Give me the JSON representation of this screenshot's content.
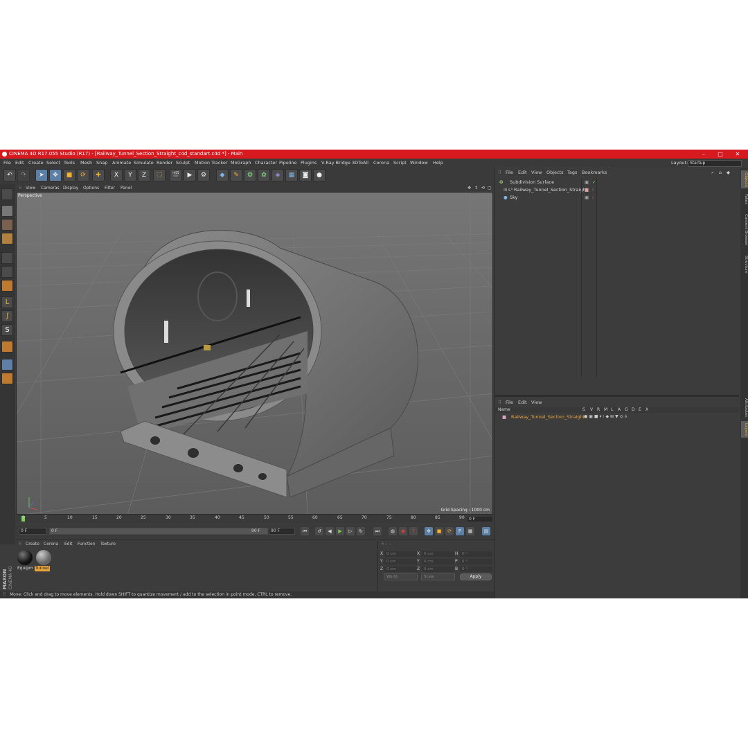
{
  "window": {
    "title": "CINEMA 4D R17.055 Studio (R17) - [Railway_Tunnel_Section_Straight_c4d_standart.c4d *] - Main",
    "controls": {
      "minimize": "–",
      "maximize": "□",
      "close": "✕"
    }
  },
  "menubar": {
    "items": [
      "File",
      "Edit",
      "Create",
      "Select",
      "Tools",
      "Mesh",
      "Snap",
      "Animate",
      "Simulate",
      "Render",
      "Sculpt",
      "Motion Tracker",
      "MoGraph",
      "Character",
      "Pipeline",
      "Plugins",
      "V-Ray Bridge",
      "3DToAll",
      "Corona",
      "Script",
      "Window",
      "Help"
    ],
    "layout_label": "Layout:",
    "layout_value": "Startup"
  },
  "toolbar": {
    "icons": [
      "undo-icon",
      "redo-icon",
      "select-arrow-icon",
      "move-icon",
      "scale-icon",
      "rotate-icon",
      "add-icon",
      "x-axis-icon",
      "y-axis-icon",
      "z-axis-icon",
      "coordinate-system-icon",
      "render-view-icon",
      "render-picture-icon",
      "render-settings-icon",
      "cube-icon",
      "pen-icon",
      "subdivision-icon",
      "array-icon",
      "deformer-icon",
      "floor-icon",
      "camera-icon",
      "light-icon"
    ],
    "axis_labels": [
      "X",
      "Y",
      "Z"
    ]
  },
  "viewport": {
    "menu": [
      "View",
      "Cameras",
      "Display",
      "Options",
      "Filter",
      "Panel"
    ],
    "label": "Perspective",
    "grid_spacing": "Grid Spacing : 1000 cm"
  },
  "timeline": {
    "ticks": [
      "0",
      "5",
      "10",
      "15",
      "20",
      "25",
      "30",
      "35",
      "40",
      "45",
      "50",
      "55",
      "60",
      "65",
      "70",
      "75",
      "80",
      "85",
      "90"
    ],
    "current_frame": "0 F",
    "start_field": "0 F",
    "start_field2": "0 F",
    "end_field": "90 F",
    "end_field2": "90 F"
  },
  "materials": {
    "menu": [
      "Create",
      "Corona",
      "Edit",
      "Function",
      "Texture"
    ],
    "items": [
      {
        "name": "Equipm",
        "color": "#222222"
      },
      {
        "name": "Tunnel",
        "color": "#888888"
      }
    ]
  },
  "coordinates": {
    "rows": [
      {
        "axis1": "X",
        "val1": "0 cm",
        "axis2": "X",
        "val2": "0 cm",
        "axis3": "H",
        "val3": "0 °"
      },
      {
        "axis1": "Y",
        "val1": "0 cm",
        "axis2": "Y",
        "val2": "0 cm",
        "axis3": "P",
        "val3": "0 °"
      },
      {
        "axis1": "Z",
        "val1": "0 cm",
        "axis2": "Z",
        "val2": "0 cm",
        "axis3": "B",
        "val3": "0 °"
      }
    ],
    "mode1": "World",
    "mode2": "Scale",
    "apply_label": "Apply"
  },
  "objects": {
    "menu": [
      "File",
      "Edit",
      "View",
      "Objects",
      "Tags",
      "Bookmarks"
    ],
    "items": [
      {
        "name": "Subdivision Surface",
        "color": "#9fd16f"
      },
      {
        "name": "Railway_Tunnel_Section_Straight",
        "color": "#d0d0d0"
      },
      {
        "name": "Sky",
        "color": "#d0d0d0"
      }
    ]
  },
  "layers": {
    "menu": [
      "File",
      "Edit",
      "View"
    ],
    "columns": [
      "Name",
      "S",
      "V",
      "R",
      "M",
      "L",
      "A",
      "G",
      "D",
      "E",
      "X"
    ],
    "items": [
      {
        "name": "Railway_Tunnel_Section_Straight",
        "color": "#e8a33c"
      }
    ]
  },
  "side_tabs": [
    "Objects",
    "Takes",
    "Content Browser",
    "Structure",
    "Attributes",
    "Layers"
  ],
  "maxon_logo": "MAXON CINEMA 4D",
  "status": "Move: Click and drag to move elements. Hold down SHIFT to quantize movement / add to the selection in point mode, CTRL to remove."
}
